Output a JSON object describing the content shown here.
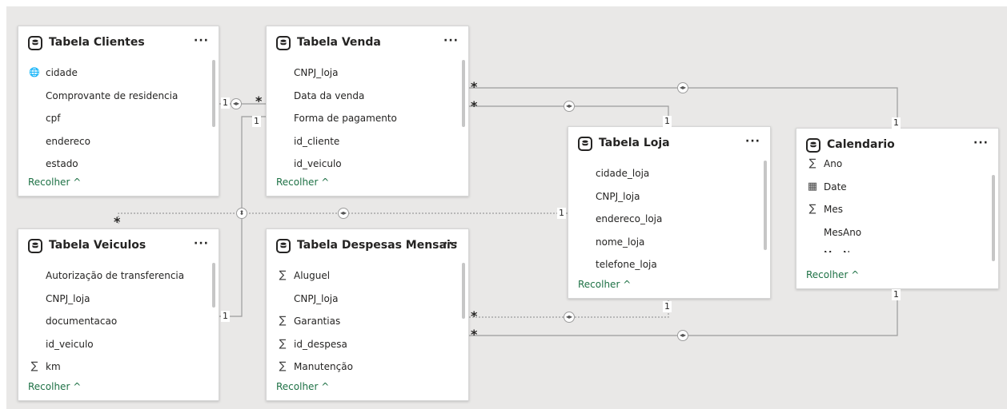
{
  "tables": {
    "clientes": {
      "title": "Tabela Clientes",
      "more": "···",
      "fields": [
        {
          "name": "cidade",
          "icon": "globe-icon"
        },
        {
          "name": "Comprovante de residencia",
          "icon": ""
        },
        {
          "name": "cpf",
          "icon": ""
        },
        {
          "name": "endereco",
          "icon": ""
        },
        {
          "name": "estado",
          "icon": ""
        }
      ],
      "collapse": "Recolher ^"
    },
    "venda": {
      "title": "Tabela Venda",
      "more": "···",
      "fields": [
        {
          "name": "CNPJ_loja",
          "icon": ""
        },
        {
          "name": "Data da venda",
          "icon": ""
        },
        {
          "name": "Forma de pagamento",
          "icon": ""
        },
        {
          "name": "id_cliente",
          "icon": ""
        },
        {
          "name": "id_veiculo",
          "icon": ""
        }
      ],
      "collapse": "Recolher ^"
    },
    "loja": {
      "title": "Tabela Loja",
      "more": "···",
      "fields": [
        {
          "name": "cidade_loja",
          "icon": ""
        },
        {
          "name": "CNPJ_loja",
          "icon": ""
        },
        {
          "name": "endereco_loja",
          "icon": ""
        },
        {
          "name": "nome_loja",
          "icon": ""
        },
        {
          "name": "telefone_loja",
          "icon": ""
        }
      ],
      "collapse": "Recolher ^"
    },
    "calendario": {
      "title": "Calendario",
      "more": "···",
      "fields": [
        {
          "name": "Ano",
          "icon": "sigma-icon"
        },
        {
          "name": "Date",
          "icon": "calendar-icon"
        },
        {
          "name": "Mes",
          "icon": "sigma-icon"
        },
        {
          "name": "MesAno",
          "icon": ""
        },
        {
          "name": "MesNome",
          "icon": ""
        }
      ],
      "collapse": "Recolher ^"
    },
    "veiculos": {
      "title": "Tabela Veiculos",
      "more": "···",
      "fields": [
        {
          "name": "Autorização de transferencia",
          "icon": ""
        },
        {
          "name": "CNPJ_loja",
          "icon": ""
        },
        {
          "name": "documentacao",
          "icon": ""
        },
        {
          "name": "id_veiculo",
          "icon": ""
        },
        {
          "name": "km",
          "icon": "sigma-icon"
        }
      ],
      "collapse": "Recolher ^"
    },
    "despesas": {
      "title": "Tabela Despesas Mensais",
      "more": "···",
      "fields": [
        {
          "name": "Aluguel",
          "icon": "sigma-icon"
        },
        {
          "name": "CNPJ_loja",
          "icon": ""
        },
        {
          "name": "Garantias",
          "icon": "sigma-icon"
        },
        {
          "name": "id_despesa",
          "icon": "sigma-icon"
        },
        {
          "name": "Manutenção",
          "icon": "sigma-icon"
        }
      ],
      "collapse": "Recolher ^"
    }
  },
  "cardinality": {
    "one": "1",
    "many": "*"
  },
  "colors": {
    "canvas": "#e9e8e7",
    "line": "#9c9c9c",
    "accent": "#1e7145"
  }
}
